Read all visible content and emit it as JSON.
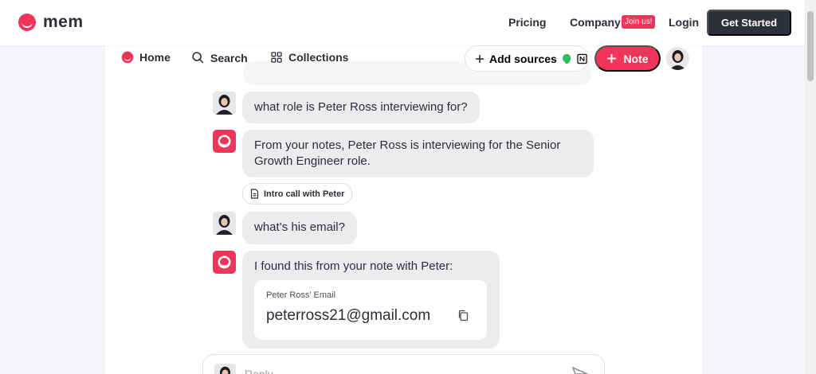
{
  "site": {
    "logo_text": "mem",
    "nav": {
      "pricing": "Pricing",
      "company": "Company",
      "join_badge": "Join us!",
      "login": "Login",
      "get_started": "Get Started"
    }
  },
  "app": {
    "nav": {
      "home": "Home",
      "search": "Search",
      "collections": "Collections"
    },
    "add_sources": "Add sources",
    "note_button": "Note"
  },
  "chat": {
    "messages": [
      {
        "from": "user",
        "text": "what role is Peter Ross interviewing for?"
      },
      {
        "from": "mem",
        "text": "From your notes, Peter Ross is interviewing for the Senior Growth Engineer role."
      },
      {
        "from": "user",
        "text": "what’s his email?"
      },
      {
        "from": "mem",
        "text": "I found this from your note with Peter:"
      }
    ],
    "source_chip": "Intro call with Peter",
    "email_card": {
      "label": "Peter Ross’ Email",
      "value": "peterross21@gmail.com"
    },
    "reply_placeholder": "Reply..."
  },
  "colors": {
    "accent": "#f0345a",
    "dark_button": "#2d3038",
    "bubble": "#ececef"
  }
}
